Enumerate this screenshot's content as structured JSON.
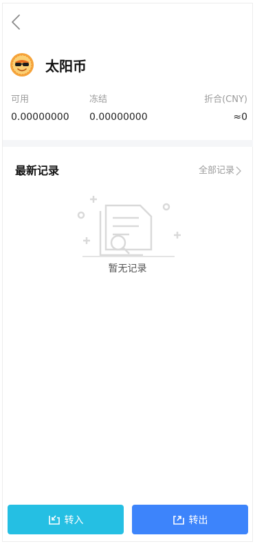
{
  "coin": {
    "name": "太阳币",
    "logo_icon": "sun-coin-logo"
  },
  "balances": {
    "available": {
      "label": "可用",
      "value": "0.00000000"
    },
    "frozen": {
      "label": "冻结",
      "value": "0.00000000"
    },
    "converted": {
      "label": "折合(CNY)",
      "value": "≈0"
    }
  },
  "records": {
    "title": "最新记录",
    "view_all_label": "全部记录",
    "empty_text": "暂无记录"
  },
  "actions": {
    "transfer_in": {
      "label": "转入",
      "color": "#25bfe3"
    },
    "transfer_out": {
      "label": "转出",
      "color": "#3d84fb"
    }
  },
  "colors": {
    "muted_text": "#9a9a9a",
    "divider": "#f5f6f8"
  }
}
